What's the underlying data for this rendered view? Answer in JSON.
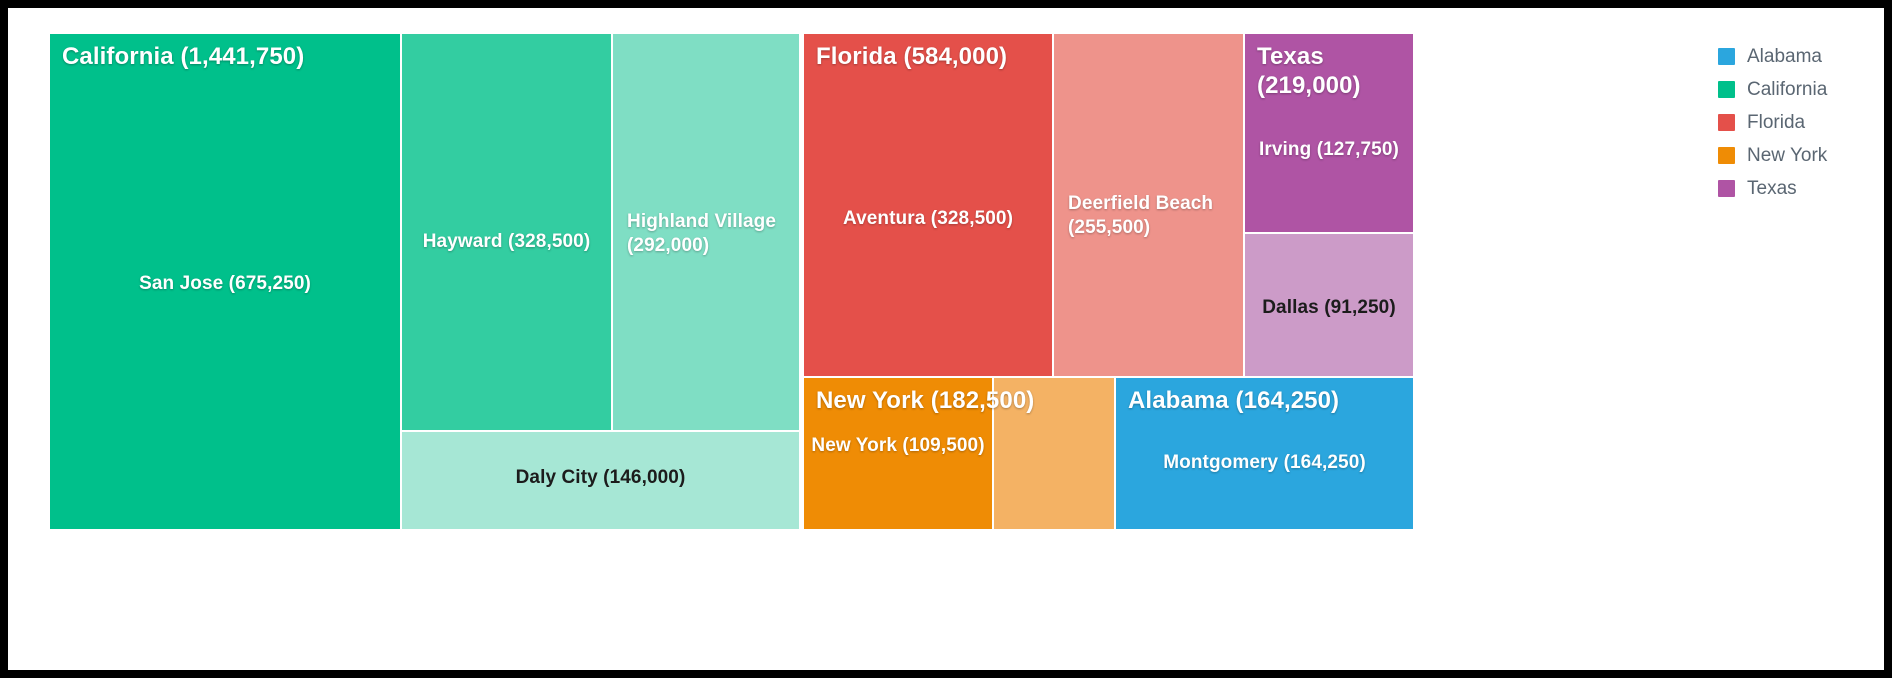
{
  "chart_data": {
    "type": "treemap",
    "title": "",
    "value_format": "comma-separated integers shown in parentheses after each name",
    "legend": {
      "position": "right",
      "entries": [
        {
          "label": "Alabama",
          "color": "#2BA6DE"
        },
        {
          "label": "California",
          "color": "#00C08B"
        },
        {
          "label": "Florida",
          "color": "#E4504A"
        },
        {
          "label": "New York",
          "color": "#EF8C05"
        },
        {
          "label": "Texas",
          "color": "#AF54A4"
        }
      ]
    },
    "groups": [
      {
        "name": "California",
        "value": 1441750,
        "label": "California (1,441,750)",
        "color": "#00C08B",
        "children": [
          {
            "name": "San Jose",
            "value": 675250,
            "label": "San Jose (675,250)",
            "color": "#00C08B"
          },
          {
            "name": "Hayward",
            "value": 328500,
            "label": "Hayward (328,500)",
            "color": "#33CDA1"
          },
          {
            "name": "Highland Village",
            "value": 292000,
            "label": "Highland Village (292,000)",
            "color": "#7FDEC4"
          },
          {
            "name": "Daly City",
            "value": 146000,
            "label": "Daly City (146,000)",
            "color": "#A6E7D5"
          }
        ]
      },
      {
        "name": "Florida",
        "value": 584000,
        "label": "Florida (584,000)",
        "color": "#E4504A",
        "children": [
          {
            "name": "Aventura",
            "value": 328500,
            "label": "Aventura (328,500)",
            "color": "#E4504A"
          },
          {
            "name": "Deerfield Beach",
            "value": 255500,
            "label": "Deerfield Beach (255,500)",
            "color": "#EE938B"
          }
        ]
      },
      {
        "name": "Texas",
        "value": 219000,
        "label": "Texas (219,000)",
        "color": "#AF54A4",
        "children": [
          {
            "name": "Irving",
            "value": 127750,
            "label": "Irving (127,750)",
            "color": "#AF54A4"
          },
          {
            "name": "Dallas",
            "value": 91250,
            "label": "Dallas (91,250)",
            "color": "#CC9BC8"
          }
        ]
      },
      {
        "name": "New York",
        "value": 182500,
        "label": "New York (182,500)",
        "color": "#EF8C05",
        "children": [
          {
            "name": "New York",
            "value": 109500,
            "label": "New York (109,500)",
            "color": "#EF8C05"
          },
          {
            "name": "New York (remainder)",
            "value": 73000,
            "label": "",
            "color": "#F4B264"
          }
        ]
      },
      {
        "name": "Alabama",
        "value": 164250,
        "label": "Alabama (164,250)",
        "color": "#2BA6DE",
        "children": [
          {
            "name": "Montgomery",
            "value": 164250,
            "label": "Montgomery (164,250)",
            "color": "#2BA6DE"
          }
        ]
      }
    ]
  },
  "cells": {
    "california_group_label": "California (1,441,750)",
    "san_jose": "San Jose (675,250)",
    "hayward": "Hayward (328,500)",
    "highland_village": "Highland Village (292,000)",
    "daly_city": "Daly City (146,000)",
    "florida_group_label": "Florida (584,000)",
    "aventura": "Aventura (328,500)",
    "deerfield_beach": "Deerfield Beach (255,500)",
    "texas_group_label": "Texas (219,000)",
    "irving": "Irving (127,750)",
    "dallas": "Dallas (91,250)",
    "newyork_group_label": "New York (182,500)",
    "newyork_city": "New York (109,500)",
    "alabama_group_label": "Alabama (164,250)",
    "montgomery": "Montgomery (164,250)"
  },
  "legend": {
    "items": [
      {
        "label": "Alabama"
      },
      {
        "label": "California"
      },
      {
        "label": "Florida"
      },
      {
        "label": "New York"
      },
      {
        "label": "Texas"
      }
    ]
  }
}
